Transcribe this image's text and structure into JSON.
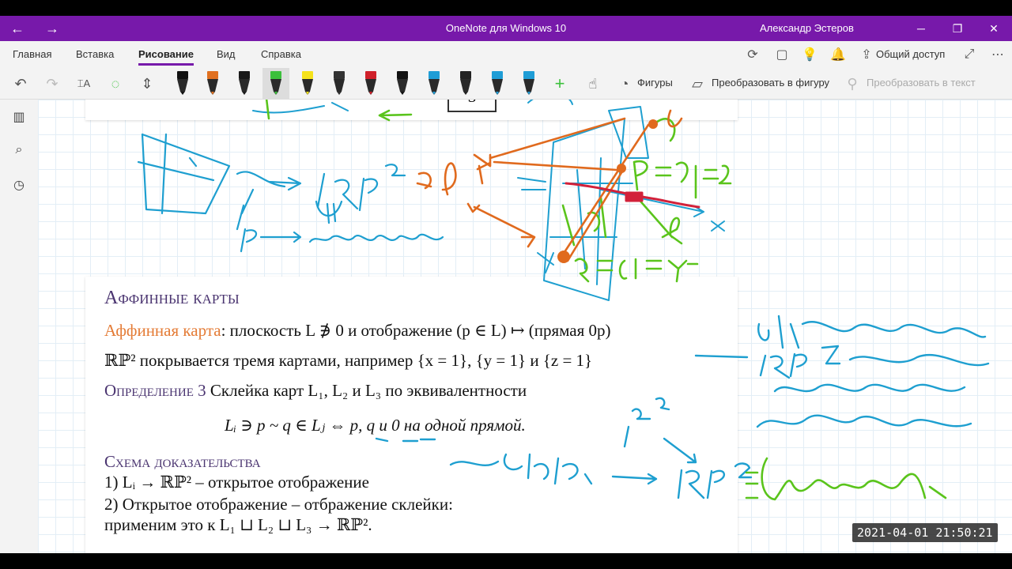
{
  "window": {
    "title": "OneNote для Windows 10",
    "user": "Александр Эстеров",
    "nav_icons": [
      "back-arrow-icon",
      "forward-arrow-icon"
    ],
    "controls": [
      "minimize-icon",
      "restore-icon",
      "close-icon"
    ],
    "accent": "#7719aa"
  },
  "ribbon": {
    "tabs": [
      "Главная",
      "Вставка",
      "Рисование",
      "Вид",
      "Справка"
    ],
    "active_tab": "Рисование",
    "share_label": "Общий доступ"
  },
  "toolbar": {
    "shapes_label": "Фигуры",
    "convert_shape_label": "Преобразовать в фигуру",
    "convert_text_label": "Преобразовать в текст",
    "pen_colors": [
      "#111111",
      "#e07020",
      "#1a1a1a",
      "#3cc03c",
      "#f5e21a",
      "#333333",
      "#d0202a",
      "#111111",
      "#1f9dd6",
      "#222222",
      "#1f9dd6",
      "#1f9dd6"
    ]
  },
  "leftnav": {
    "icons": [
      "notebooks-icon",
      "search-icon",
      "recent-icon"
    ]
  },
  "slide_top": {
    "label": "S"
  },
  "slide": {
    "title": "Аффинные карты",
    "line1_term": "Аффинная карта",
    "line1_rest": ": плоскость L ∌ 0 и отображение (p ∈ L) ↦ (прямая 0p)",
    "line2": "ℝℙ² покрывается тремя картами, например {x = 1}, {y = 1} и {z = 1}",
    "def_label": "Определение 3",
    "def_text": " Склейка карт L₁, L₂ и L₃ по эквивалентности",
    "def_formula": "Lᵢ ∋ p ~ q ∈ Lⱼ  ⇔  p, q и 0 на одной прямой.",
    "proof_label": "Схема доказательства",
    "proof_1": "1) Lᵢ → ℝℙ² – открытое отображение",
    "proof_2": "2) Открытое отображение – отбражение склейки:",
    "proof_3": "применим это к L₁ ⊔ L₂ ⊔ L₃ → ℝℙ²."
  },
  "ink_colors": {
    "blue": "#1e9fd0",
    "green": "#5ac41c",
    "orange": "#e06a1e",
    "red": "#d2213a"
  },
  "timestamp": "2021-04-01  21:50:21"
}
